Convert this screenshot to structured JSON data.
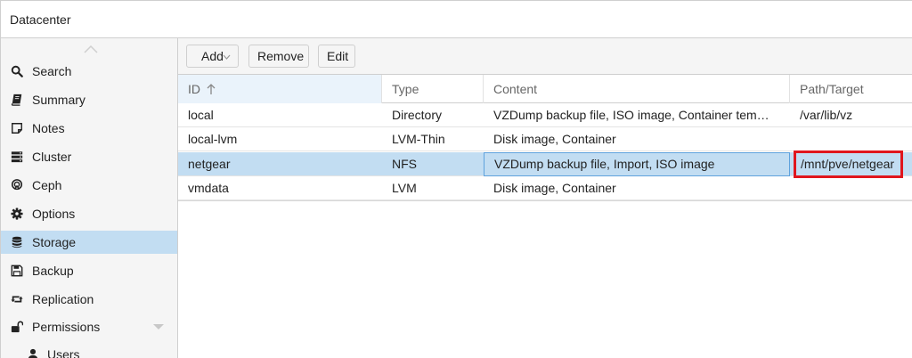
{
  "header": {
    "title": "Datacenter"
  },
  "sidebar": {
    "items": [
      {
        "label": "Search",
        "icon": "search-icon"
      },
      {
        "label": "Summary",
        "icon": "book-icon"
      },
      {
        "label": "Notes",
        "icon": "note-icon"
      },
      {
        "label": "Cluster",
        "icon": "server-icon"
      },
      {
        "label": "Ceph",
        "icon": "ceph-icon"
      },
      {
        "label": "Options",
        "icon": "gear-icon"
      },
      {
        "label": "Storage",
        "icon": "database-icon",
        "active": true
      },
      {
        "label": "Backup",
        "icon": "floppy-icon"
      },
      {
        "label": "Replication",
        "icon": "retweet-icon"
      },
      {
        "label": "Permissions",
        "icon": "unlock-icon",
        "expandable": true
      },
      {
        "label": "Users",
        "icon": "user-icon",
        "sub": true
      }
    ]
  },
  "toolbar": {
    "add_label": "Add",
    "remove_label": "Remove",
    "edit_label": "Edit"
  },
  "table": {
    "columns": [
      "ID",
      "Type",
      "Content",
      "Path/Target"
    ],
    "sorted_column": "ID",
    "rows": [
      {
        "id": "local",
        "type": "Directory",
        "content": "VZDump backup file, ISO image, Container tem…",
        "path": "/var/lib/vz"
      },
      {
        "id": "local-lvm",
        "type": "LVM-Thin",
        "content": "Disk image, Container",
        "path": ""
      },
      {
        "id": "netgear",
        "type": "NFS",
        "content": "VZDump backup file, Import, ISO image",
        "path": "/mnt/pve/netgear"
      },
      {
        "id": "vmdata",
        "type": "LVM",
        "content": "Disk image, Container",
        "path": ""
      }
    ],
    "selected_row": "netgear"
  },
  "colors": {
    "selection": "#c2ddf2",
    "sidebar_bg": "#f5f5f5",
    "highlight": "#e0161d",
    "focus_border": "#5fa2dd"
  }
}
